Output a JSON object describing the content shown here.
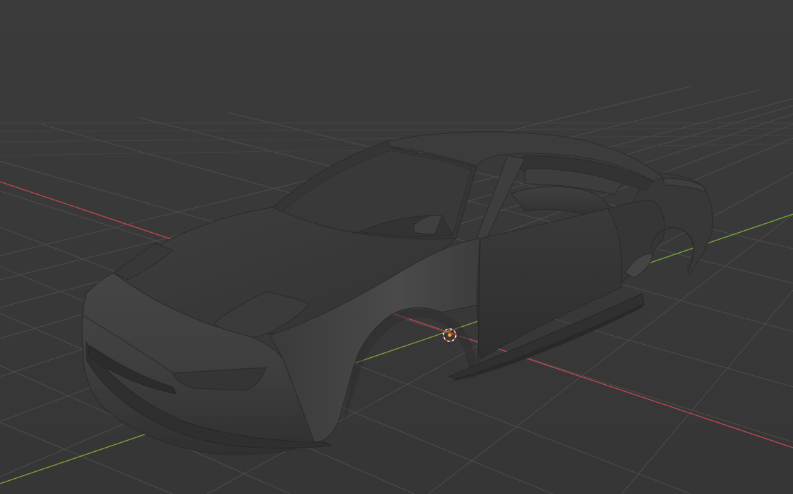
{
  "viewport": {
    "mode": "3d-viewport",
    "shading": "solid",
    "object": "car-body",
    "background_color": "#393939",
    "grid_color": "#4f4f4f",
    "x_axis_color": "#c0464f",
    "y_axis_color": "#7aa23a",
    "cursor_icon": "3d-cursor-icon"
  }
}
